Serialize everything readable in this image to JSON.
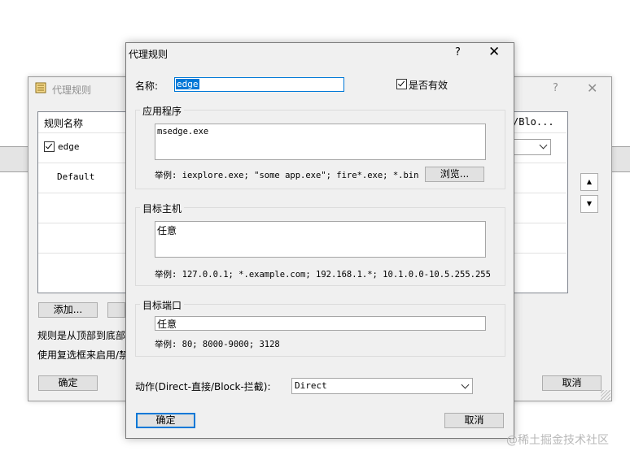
{
  "back_dialog": {
    "title": "代理规则",
    "help": "?",
    "close": "✕",
    "columns": [
      "规则名称",
      "/Blo..."
    ],
    "rows": [
      {
        "name": "edge",
        "checked": true
      },
      {
        "name": "Default",
        "checked": false
      }
    ],
    "add_label": "添加...",
    "info_line1": "规则是从顶部到底部",
    "info_line2": "使用复选框来启用/禁",
    "ok_label": "确定",
    "cancel_label": "取消"
  },
  "front_dialog": {
    "title": "代理规则",
    "help": "?",
    "close": "✕",
    "name_label": "名称:",
    "name_value": "edge",
    "enabled_label": "是否有效",
    "enabled": true,
    "app_group": {
      "label": "应用程序",
      "value": "msedge.exe",
      "example": "举例: iexplore.exe; \"some app.exe\"; fire*.exe; *.bin",
      "browse_label": "浏览..."
    },
    "host_group": {
      "label": "目标主机",
      "value": "任意",
      "example": "举例: 127.0.0.1; *.example.com; 192.168.1.*; 10.1.0.0-10.5.255.255"
    },
    "port_group": {
      "label": "目标端口",
      "value": "任意",
      "example": "举例: 80; 8000-9000; 3128"
    },
    "action_label": "动作(Direct-直接/Block-拦截):",
    "action_value": "Direct",
    "ok_label": "确定",
    "cancel_label": "取消"
  },
  "watermark": "@稀土掘金技术社区"
}
